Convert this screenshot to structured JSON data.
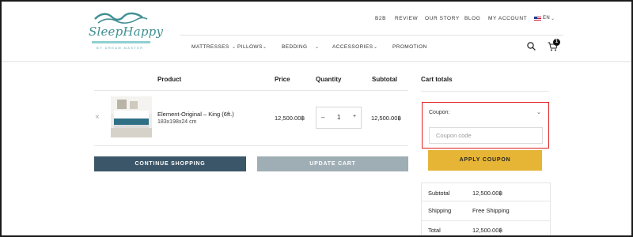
{
  "brand": {
    "name": "SleepHappy",
    "tagline": "BY DREAM MASTER"
  },
  "top_nav": [
    "B2B",
    "REVIEW",
    "OUR STORY",
    "BLOG",
    "MY ACCOUNT"
  ],
  "language": "EN",
  "main_nav": [
    {
      "label": "MATTRESSES"
    },
    {
      "label": "PILLOWS"
    },
    {
      "label": "BEDDING"
    },
    {
      "label": "ACCESSORIES"
    },
    {
      "label": "PROMOTION"
    }
  ],
  "cart_count": "1",
  "table": {
    "headers": {
      "product": "Product",
      "price": "Price",
      "quantity": "Quantity",
      "subtotal": "Subtotal"
    },
    "rows": [
      {
        "name": "Element-Original – King (6ft.)",
        "size": "183x198x24 cm",
        "price": "12,500.00฿",
        "quantity": "1",
        "subtotal": "12,500.00฿"
      }
    ],
    "continue_label": "CONTINUE SHOPPING",
    "update_label": "UPDATE CART"
  },
  "totals": {
    "title": "Cart totals",
    "coupon_label": "Coupon:",
    "coupon_placeholder": "Coupon code",
    "apply_label": "APPLY COUPON",
    "rows": [
      {
        "label": "Subtotal",
        "value": "12,500.00฿"
      },
      {
        "label": "Shipping",
        "value": "Free Shipping"
      },
      {
        "label": "Total",
        "value": "12,500.00฿"
      }
    ]
  },
  "icons": {
    "qty_minus": "–",
    "qty_plus": "+",
    "remove": "×",
    "chevron": "⌄"
  },
  "colors": {
    "brand_teal": "#3f8f92",
    "continue_button": "#3b5668",
    "update_button": "#9fadb5",
    "apply_button": "#e6b536",
    "highlight_border": "#e02020"
  }
}
